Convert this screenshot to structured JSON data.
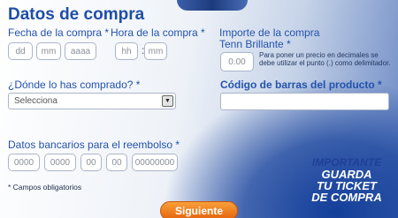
{
  "title": "Datos de compra",
  "fecha": {
    "label": "Fecha de la compra *",
    "dd": "dd",
    "mm": "mm",
    "aaaa": "aaaa"
  },
  "hora": {
    "label": "Hora de la compra *",
    "hh": "hh",
    "mm": "mm",
    "sep": ":"
  },
  "importe": {
    "label_line1": "Importe de la compra",
    "label_line2": "Tenn Brillante *",
    "placeholder": "0.00",
    "note": "Para poner un precio en decimales se debe utilizar el punto (.) como delimitador."
  },
  "donde": {
    "label": "¿Dónde lo has comprado? *",
    "selected": "Selecciona"
  },
  "codigo": {
    "label": "Código de barras del producto *"
  },
  "bancarios": {
    "label": "Datos bancarios para el reembolso *",
    "fields": [
      "0000",
      "0000",
      "00",
      "00",
      "00000000"
    ]
  },
  "required_note": "* Campos obligatorios",
  "button": "Siguiente",
  "importante": {
    "line1": "IMPORTANTE",
    "line2": "GUARDA",
    "line3": "TU TICKET",
    "line4": "DE COMPRA"
  }
}
